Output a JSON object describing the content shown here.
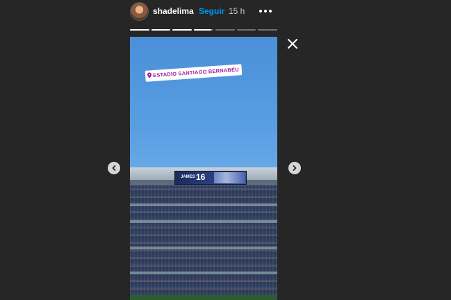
{
  "header": {
    "username": "shadelima",
    "separator": "•",
    "follow_label": "Seguir",
    "time": "15 h",
    "more_icon": "more-horizontal-icon",
    "avatar_icon": "avatar"
  },
  "progress": {
    "segments": [
      1,
      1,
      1,
      0.9,
      0,
      0,
      0
    ]
  },
  "story": {
    "location_label": "ESTADIO SANTIAGO BERNABÉU",
    "scoreboard": {
      "name": "JAMES",
      "number": "16"
    }
  },
  "controls": {
    "close_icon": "close-icon",
    "prev_icon": "chevron-left-icon",
    "next_icon": "chevron-right-icon"
  },
  "colors": {
    "background": "#262626",
    "follow": "#0095f6",
    "location_text": "#a020a0"
  }
}
